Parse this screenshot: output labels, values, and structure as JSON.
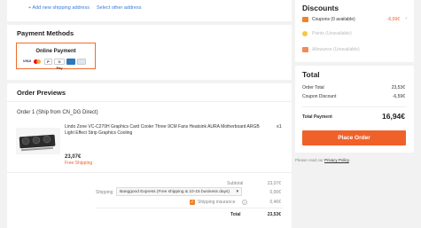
{
  "address": {
    "add_link": "+ Add new shipping address",
    "select_link": "Select other address"
  },
  "payment": {
    "title": "Payment Methods",
    "option_label": "Online Payment",
    "icons": [
      "VISA",
      "MC",
      "PayPal",
      "G Pay",
      "Amex",
      "Bank"
    ]
  },
  "orders": {
    "title": "Order Previews",
    "group_label": "Order 1 (Ship from CN_DG Direct)",
    "item": {
      "name": "Lindo Zone VC-C270H Graphics Card Cooler Three 9CM Fans Heatsink AURA Motherboard ARGB Light Effect Strip Graphics Cooling",
      "qty": "x1",
      "price": "23,07€",
      "shipping_tag": "Free Shipping"
    },
    "subtotal_label": "Subtotal",
    "subtotal_value": "23,07€",
    "shipping_label": "Shipping",
    "shipping_option": "Banggood Express (Free shipping & 10-15 business days)",
    "shipping_value": "0,00€",
    "insurance_label": "Shipping insurance",
    "insurance_value": "0,46€",
    "total_label": "Total",
    "total_value": "23,53€"
  },
  "discounts": {
    "title": "Discounts",
    "coupons_label": "Coupons (0 available)",
    "coupons_value": "-6,59€",
    "points_label": "Points (Unavailable)",
    "allowance_label": "Allowance (Unavailable)"
  },
  "summary": {
    "title": "Total",
    "order_total_label": "Order Total",
    "order_total_value": "23,53€",
    "coupon_discount_label": "Coupon Discount",
    "coupon_discount_value": "-6,59€",
    "total_payment_label": "Total Payment",
    "total_payment_value": "16,94€",
    "place_order": "Place Order",
    "policy_prefix": "Please read our",
    "policy_link": "Privacy Policy",
    "policy_suffix": "."
  },
  "colors": {
    "accent": "#f0612a",
    "link": "#3a7bd5"
  }
}
